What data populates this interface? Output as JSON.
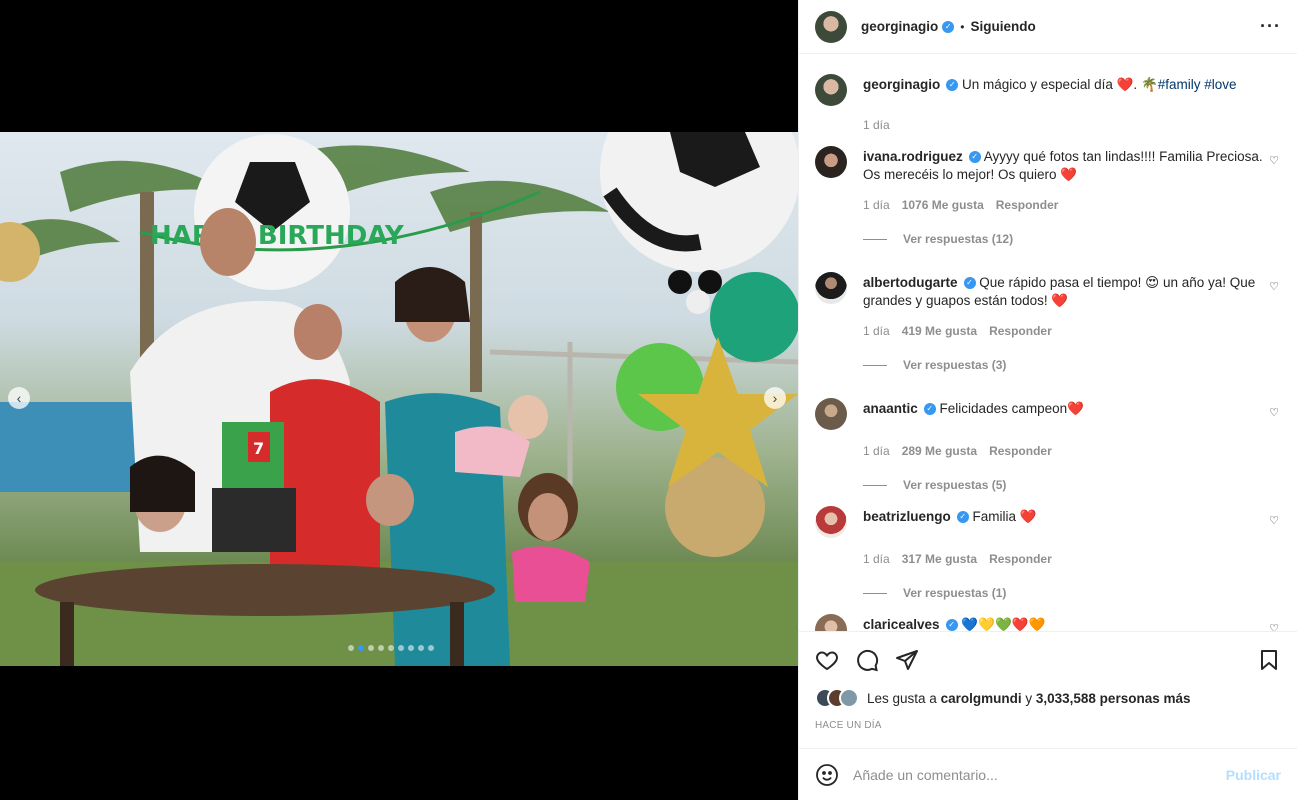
{
  "post": {
    "author": "georginagio",
    "follow_status": "Siguiendo",
    "bullet": "•",
    "more_icon": "more-horizontal-icon"
  },
  "caption": {
    "username": "georginagio",
    "text": "Un mágico y especial día",
    "heart": "❤️",
    "sep": ".",
    "palm": "🌴",
    "tag1": "#family",
    "tag2": "#love",
    "time": "1 día"
  },
  "comments": [
    {
      "username": "ivana.rodriguez",
      "text": "Ayyyy qué fotos tan lindas!!!! Familia Preciosa. Os merecéis lo mejor! Os quiero",
      "emoji": "❤️",
      "time": "1 día",
      "likes": "1076 Me gusta",
      "reply": "Responder",
      "replies": "Ver respuestas (12)"
    },
    {
      "username": "albertodugarte",
      "text": "Que rápido pasa el tiempo! 😍 un año ya! Que grandes y guapos están todos!",
      "emoji": "❤️",
      "time": "1 día",
      "likes": "419 Me gusta",
      "reply": "Responder",
      "replies": "Ver respuestas (3)"
    },
    {
      "username": "anaantic",
      "text": "Felicidades campeon",
      "emoji": "❤️",
      "time": "1 día",
      "likes": "289 Me gusta",
      "reply": "Responder",
      "replies": "Ver respuestas (5)"
    },
    {
      "username": "beatrizluengo",
      "text": "Familia",
      "emoji": "❤️",
      "time": "1 día",
      "likes": "317 Me gusta",
      "reply": "Responder",
      "replies": "Ver respuestas (1)"
    },
    {
      "username": "claricealves",
      "text": "💙💛💚❤️🧡",
      "emoji": "",
      "time": "",
      "likes": "",
      "reply": "",
      "replies": ""
    }
  ],
  "likes": {
    "prefix": "Les gusta a",
    "user": "carolgmundi",
    "conj": "y",
    "count": "3,033,588 personas más"
  },
  "timestamp": "HACE UN DÍA",
  "composer": {
    "placeholder": "Añade un comentario...",
    "post_label": "Publicar"
  },
  "media": {
    "banner": "HAPPY BIRTHDAY",
    "cake_number": "7",
    "slides": 9,
    "active_slide": 2
  },
  "colors": {
    "verified": "#3897f0",
    "link": "#00376b",
    "muted": "#8e8e8e",
    "post_button_disabled": "#b2dffc",
    "heart": "#ed4956"
  }
}
